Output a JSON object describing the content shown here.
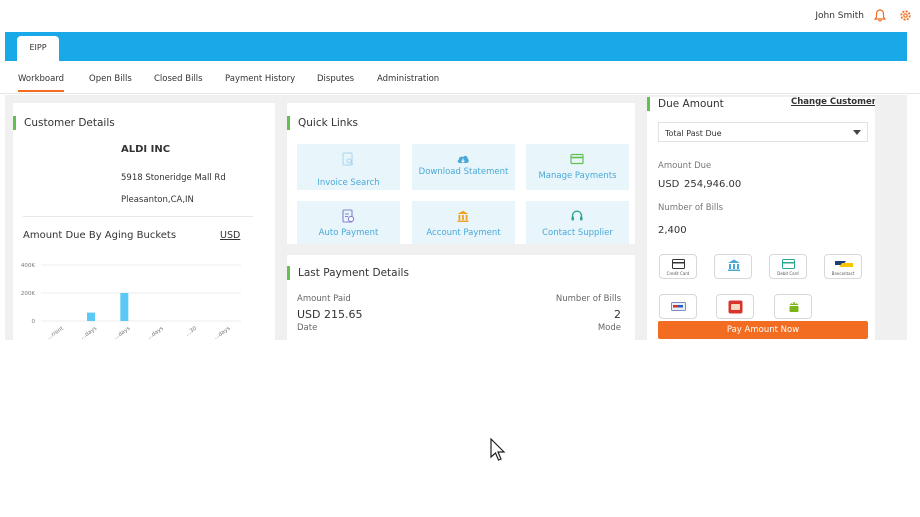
{
  "header": {
    "user_name": "John Smith",
    "app_tab": "EIPP"
  },
  "nav": {
    "tabs": [
      "Workboard",
      "Open Bills",
      "Closed Bills",
      "Payment History",
      "Disputes",
      "Administration"
    ]
  },
  "customer": {
    "title": "Customer Details",
    "name": "ALDI INC",
    "address1": "5918 Stoneridge Mall Rd",
    "address2": "Pleasanton,CA,IN"
  },
  "aging": {
    "title": "Amount Due By Aging Buckets",
    "currency": "USD",
    "chart_data": {
      "type": "bar",
      "categories": [
        "...rrent",
        "...days",
        "...days",
        "...days",
        "...30",
        "...days"
      ],
      "values": [
        0,
        60000,
        200000,
        0,
        0,
        0
      ],
      "ylim": [
        0,
        400000
      ],
      "yticks": [
        "400K",
        "200K",
        "0"
      ],
      "color": "#5bc8f5"
    }
  },
  "quick_links": {
    "title": "Quick Links",
    "items": [
      {
        "label": "Invoice Search",
        "icon": "invoice-search-icon"
      },
      {
        "label": "Download Statement",
        "icon": "download-cloud-icon"
      },
      {
        "label": "Manage Payments",
        "icon": "payment-card-icon"
      },
      {
        "label": "Auto Payment",
        "icon": "auto-payment-icon"
      },
      {
        "label": "Account Payment",
        "icon": "bank-icon"
      },
      {
        "label": "Contact Supplier",
        "icon": "headset-icon"
      }
    ]
  },
  "last_payment": {
    "title": "Last Payment Details",
    "amount_paid_label": "Amount Paid",
    "amount_paid": "USD 215.65",
    "bills_label": "Number of Bills",
    "bills": "2",
    "date_label": "Date",
    "mode_label": "Mode"
  },
  "due": {
    "title": "Due Amount",
    "change_customer": "Change Customer",
    "select_value": "Total Past Due",
    "amount_label": "Amount Due",
    "currency": "USD",
    "amount": "254,946.00",
    "bills_label": "Number of Bills",
    "bills": "2,400",
    "methods": [
      "Credit Card",
      "",
      "Debit Card",
      "Bancontact",
      "",
      "",
      ""
    ],
    "pay_button": "Pay Amount Now"
  },
  "colors": {
    "brand_blue": "#19a9e8",
    "accent_orange": "#f26c21",
    "accent_green": "#63c04e",
    "link_blue": "#4aa8d8"
  }
}
